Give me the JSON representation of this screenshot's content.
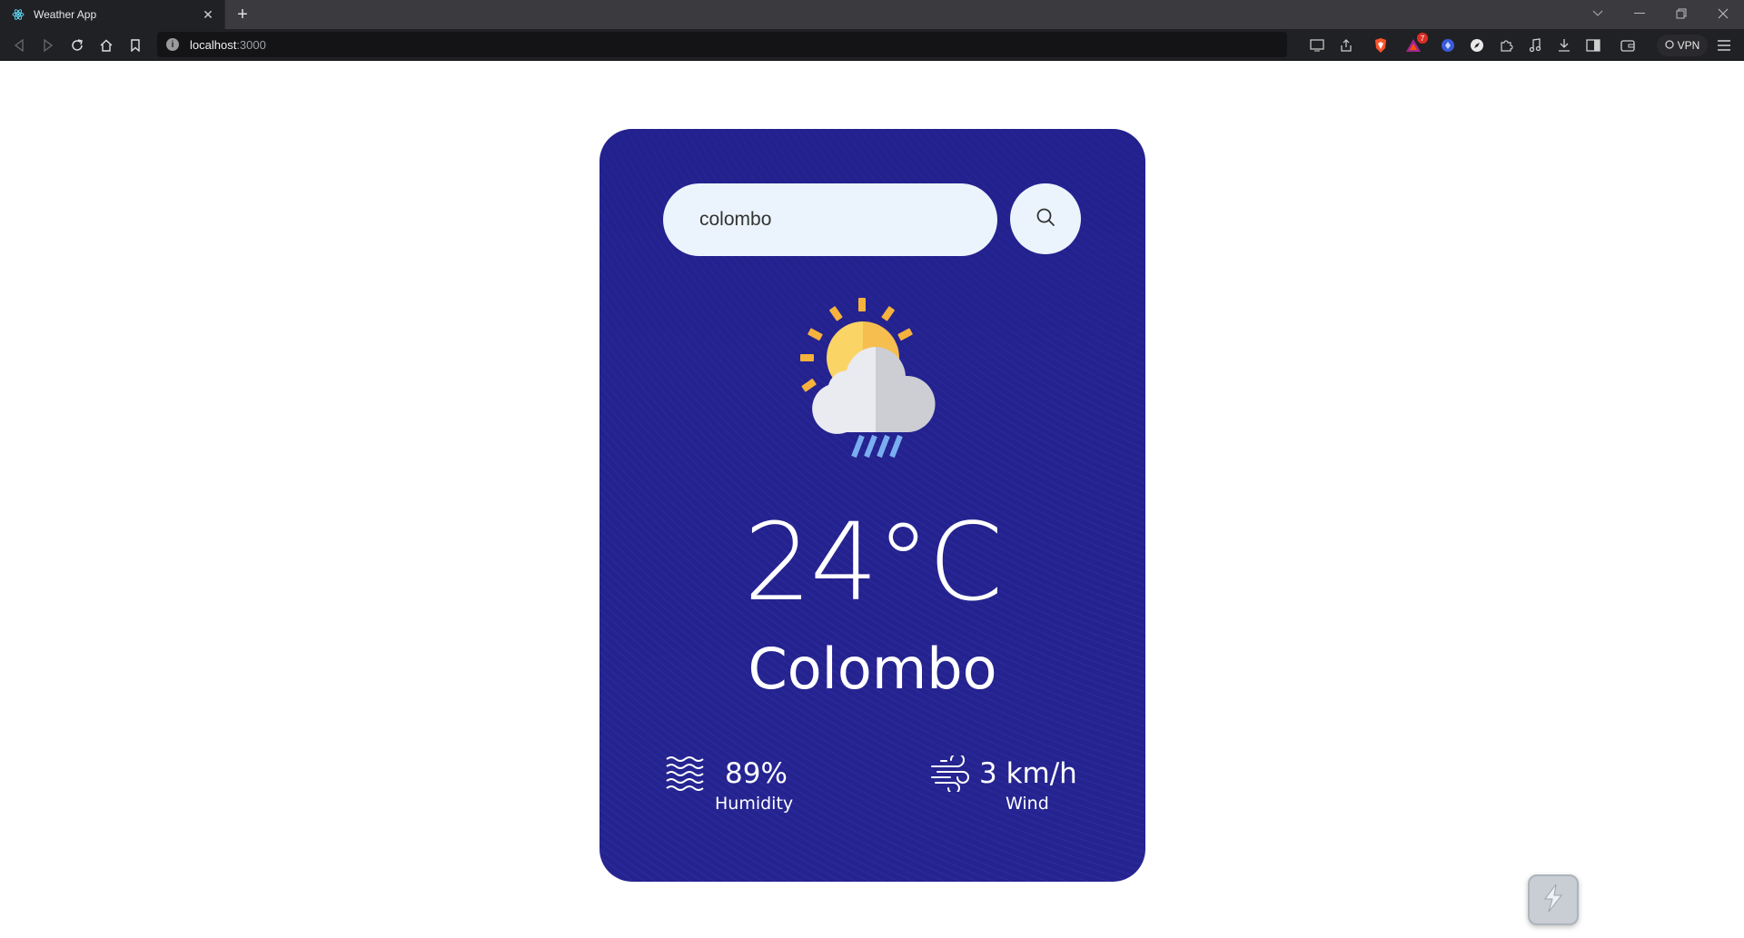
{
  "browser": {
    "tab": {
      "title": "Weather App",
      "favicon": "react-logo-icon"
    },
    "url": {
      "host": "localhost",
      "port": ":3000"
    },
    "vpn_label": "VPN",
    "brave_rewards_badge": "7"
  },
  "weather": {
    "search": {
      "value": "colombo",
      "placeholder": ""
    },
    "condition_icon": "sun-cloud-rain-icon",
    "temperature": "24°C",
    "city": "Colombo",
    "humidity": {
      "value": "89%",
      "label": "Humidity"
    },
    "wind": {
      "value": "3 km/h",
      "label": "Wind"
    }
  },
  "colors": {
    "card_background": "#26248f",
    "search_background": "#ebf4fc",
    "text": "#ffffff",
    "browser_chrome": "#202124"
  }
}
